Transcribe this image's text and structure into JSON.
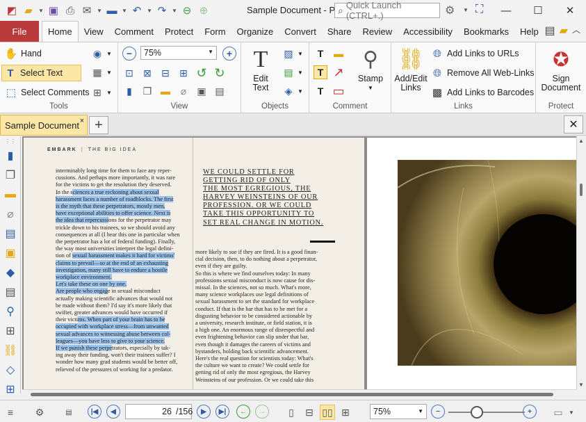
{
  "window": {
    "title": "Sample Document - P..",
    "quick_launch_placeholder": "Quick Launch (CTRL+.)",
    "minimize": "—",
    "maximize": "☐",
    "close": "✕"
  },
  "menu": {
    "file": "File",
    "items": [
      "Home",
      "View",
      "Comment",
      "Protect",
      "Form",
      "Organize",
      "Convert",
      "Share",
      "Review",
      "Accessibility",
      "Bookmarks",
      "Help"
    ],
    "active": "Home"
  },
  "ribbon": {
    "tools": {
      "label": "Tools",
      "hand": "Hand",
      "select_text": "Select Text",
      "select_comments": "Select Comments"
    },
    "view": {
      "label": "View",
      "zoom": "75%"
    },
    "objects": {
      "label": "Objects",
      "edit_text": "Edit",
      "edit_text2": "Text"
    },
    "comment": {
      "label": "Comment",
      "stamp": "Stamp"
    },
    "links": {
      "label": "Links",
      "add_edit_links": "Add/Edit",
      "add_edit_links2": "Links",
      "add_links_to_urls": "Add Links to URLs",
      "remove_all_web_links": "Remove All Web-Links",
      "add_links_to_barcodes": "Add Links to Barcodes"
    },
    "protect": {
      "label": "Protect",
      "sign_document": "Sign",
      "sign_document2": "Document"
    }
  },
  "document_tab": {
    "name": "Sample Document",
    "close": "×",
    "new_tab": "+",
    "close_doc": "✕"
  },
  "page": {
    "header_brand": "EMBARK",
    "header_pipe": "|",
    "header_section": "THE BIG IDEA",
    "col1": [
      {
        "t": "interminably long time for them to face any reper-"
      },
      {
        "t": "cussions. And perhaps more importantly, it was rare"
      },
      {
        "t": "for the victims to get the resolution they deserved."
      },
      {
        "t": "    In the s",
        "h": "ciences a true reckoning about sexual"
      },
      {
        "h": "harassment faces a number of roadblocks. The first"
      },
      {
        "h": "is the myth that these perpetrators, mostly men,"
      },
      {
        "h": "have exceptional abilities to offer science. Next is"
      },
      {
        "h": "the idea that repercussi",
        "t2": "ons for the perpetrator may"
      },
      {
        "t": "trickle down to his trainees, so we should avoid any"
      },
      {
        "t": "consequences at all (I hear this one in particular when"
      },
      {
        "t": "the perpetrator has a lot of federal funding). Finally,"
      },
      {
        "t": "the way most universities interpret the legal defini-"
      },
      {
        "t": "tion of ",
        "h": "sexual harassment makes it hard for victims'"
      },
      {
        "h": "claims to prevail—so at the end of an exhausting"
      },
      {
        "h": "investigation, many still have to endure a hostile"
      },
      {
        "h": "workplace environment."
      },
      {
        "h": "    Let's take these on one by one."
      },
      {
        "h": "    Are people who engag",
        "t2": "e in sexual misconduct"
      },
      {
        "t": "actually making scientific advances that would not"
      },
      {
        "t": "be made without them? I'd say it's more likely that"
      },
      {
        "t": "swifter, greater advances would have occurred if"
      },
      {
        "t": "their victi",
        "h": "ms. When part of your brain has to be"
      },
      {
        "h": "occupied with workplace stress—from unwanted"
      },
      {
        "h": "sexual advances to witnessing abuse between col-"
      },
      {
        "h": "leagues—you have less to give to your science."
      },
      {
        "h": "    If we punish these perpe",
        "t2": "trators, especially by tak-"
      },
      {
        "t": "ing away their funding, won't their trainees suffer? I"
      },
      {
        "t": "wonder how many grad students would be better off,"
      },
      {
        "t": "relieved of the pressures of working for a predator."
      }
    ],
    "pull_quote": [
      "WE COULD SETTLE FOR",
      "GETTING RID OF ONLY",
      "THE MOST EGREGIOUS, THE",
      "HARVEY WEINSTEINS OF OUR",
      "PROFESSION. OR WE COULD",
      "TAKE THIS OPPORTUNITY TO",
      "SET REAL CHANGE IN MOTION."
    ],
    "col2": [
      "more likely to sue if they are fired. It is a good finan-",
      "cial decision, then, to do nothing about a perpetrator,",
      "even if they are guilty.",
      "    So this is where we find ourselves today: In many",
      "professions sexual misconduct is now cause for dis-",
      "missal. In the sciences, not so much. What's more,",
      "many science workplaces use legal definitions of",
      "sexual harassment to set the standard for workplace",
      "conduct. If that is the bar that has to be met for a",
      "disgusting behavior to be considered actionable by",
      "a university, research institute, or field station, it is",
      "a high one. An enormous range of disrespectful and",
      "even frightening behavior can slip under that bar,",
      "even though it damages the careers of victims and",
      "bystanders, holding back scientific advancement.",
      "    Here's the real question for scientists today: What's",
      "the culture we want to create? We could settle for",
      "getting rid of only the most egregious, the Harvey",
      "Weinsteins of our profession. Or we could take this"
    ]
  },
  "status": {
    "current_page": "26",
    "total_pages": "/156",
    "zoom": "75%"
  }
}
